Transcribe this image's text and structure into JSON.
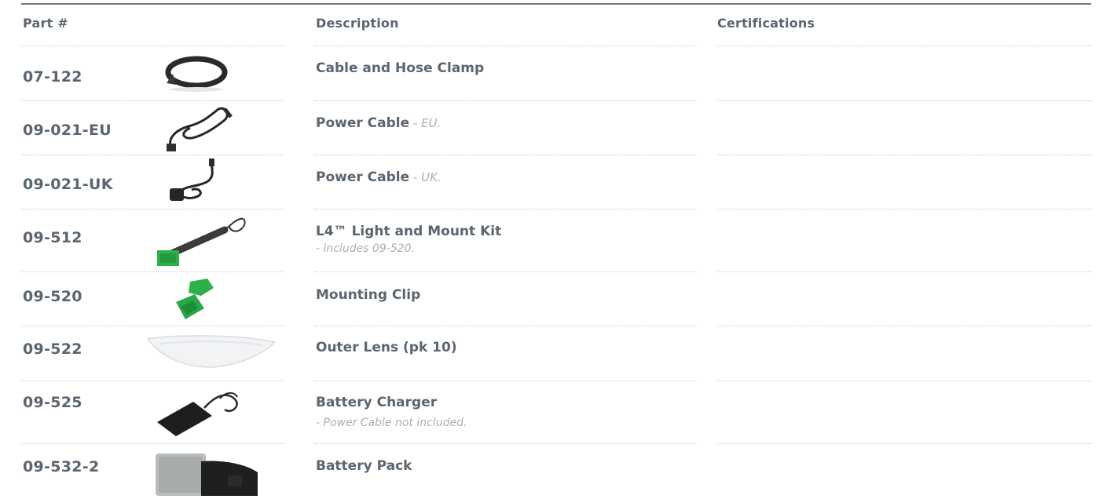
{
  "table": {
    "headers": {
      "part": "Part #",
      "description": "Description",
      "certifications": "Certifications"
    },
    "rows": [
      {
        "part": "07-122",
        "title": "Cable and Hose Clamp",
        "note": "",
        "sub": "",
        "image": "hose-clamp-image"
      },
      {
        "part": "09-021-EU",
        "title": "Power Cable",
        "note": " - EU.",
        "sub": "",
        "image": "power-cable-eu-image"
      },
      {
        "part": "09-021-UK",
        "title": "Power Cable",
        "note": " - UK.",
        "sub": "",
        "image": "power-cable-uk-image"
      },
      {
        "part": "09-512",
        "title": "L4™ Light and Mount Kit",
        "note": "",
        "sub": "- includes 09-520.",
        "image": "light-mount-kit-image"
      },
      {
        "part": "09-520",
        "title": "Mounting Clip",
        "note": "",
        "sub": "",
        "image": "mounting-clip-image"
      },
      {
        "part": "09-522",
        "title": "Outer Lens (pk 10)",
        "note": "",
        "sub": "",
        "image": "outer-lens-image"
      },
      {
        "part": "09-525",
        "title": "Battery Charger",
        "note": "",
        "sub": "- Power Cable not included.",
        "image": "battery-charger-image"
      },
      {
        "part": "09-532-2",
        "title": "Battery Pack",
        "note": "",
        "sub": "",
        "image": "battery-pack-image"
      }
    ]
  },
  "colors": {
    "text": "#5b6570",
    "note": "#a9b0b6",
    "rule": "#6f7780",
    "clip_green": "#2db04a"
  }
}
